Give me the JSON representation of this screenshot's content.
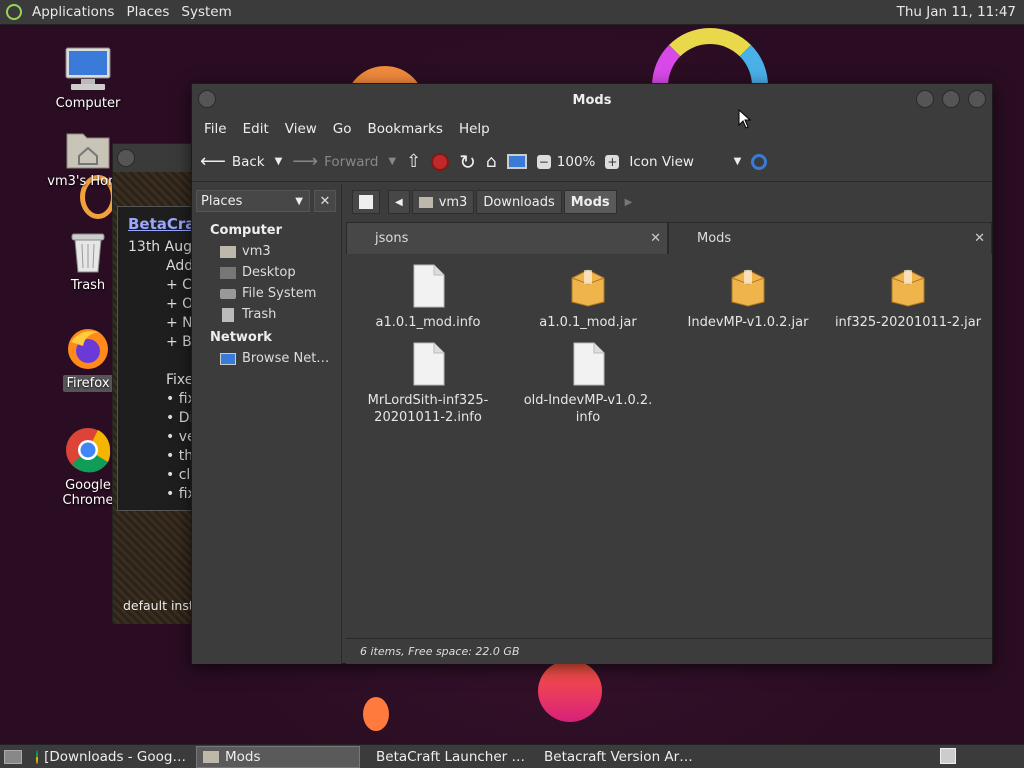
{
  "top_panel": {
    "menus": [
      "Applications",
      "Places",
      "System"
    ],
    "clock": "Thu Jan 11, 11:47"
  },
  "desktop_icons": [
    {
      "label": "Computer",
      "icon": "computer-icon"
    },
    {
      "label": "vm3's Home",
      "icon": "home-folder-icon"
    },
    {
      "label": "Trash",
      "icon": "trash-icon"
    },
    {
      "label": "Firefox",
      "icon": "firefox-icon"
    },
    {
      "label": "Google Chrome",
      "icon": "chrome-icon"
    }
  ],
  "bg_window": {
    "link": "BetaCraft",
    "lines": [
      "13th August",
      "Added",
      "+ C",
      "+ O",
      "+ N",
      "+ B",
      "",
      "Fixed",
      "• fix",
      "• Dis",
      "• ve",
      "• the",
      "• cli",
      "• fix"
    ],
    "footer": "default instance"
  },
  "file_manager": {
    "title": "Mods",
    "menu": [
      "File",
      "Edit",
      "View",
      "Go",
      "Bookmarks",
      "Help"
    ],
    "toolbar": {
      "back": "Back",
      "forward": "Forward",
      "zoom": "100%",
      "view_mode": "Icon View"
    },
    "places_label": "Places",
    "sidebar": {
      "computer_head": "Computer",
      "computer_items": [
        "vm3",
        "Desktop",
        "File System",
        "Trash"
      ],
      "network_head": "Network",
      "network_items": [
        "Browse Net…"
      ]
    },
    "path": [
      "vm3",
      "Downloads",
      "Mods"
    ],
    "tabs": [
      {
        "label": "jsons",
        "active": false
      },
      {
        "label": "Mods",
        "active": true
      }
    ],
    "files": [
      {
        "name": "a1.0.1_mod.info",
        "type": "document"
      },
      {
        "name": "a1.0.1_mod.jar",
        "type": "package"
      },
      {
        "name": "IndevMP-v1.0.2.jar",
        "type": "package"
      },
      {
        "name": "inf325-20201011-2.jar",
        "type": "package"
      },
      {
        "name": "MrLordSith-inf325-20201011-2.info",
        "line1": "MrLordSith-inf325-",
        "line2": "20201011-2.info",
        "type": "document"
      },
      {
        "name": "old-IndevMP-v1.0.2.info",
        "line1": "old-IndevMP-v1.0.2.",
        "line2": "info",
        "type": "document"
      }
    ],
    "status": "6 items, Free space: 22.0 GB"
  },
  "taskbar": [
    {
      "label": "[Downloads - Goog…",
      "icon": "chrome-icon",
      "active": false
    },
    {
      "label": "Mods",
      "icon": "folder-icon",
      "active": true
    },
    {
      "label": "BetaCraft Launcher …",
      "icon": "java-icon",
      "active": false
    },
    {
      "label": "Betacraft Version Ar…",
      "icon": "java-icon",
      "active": false
    }
  ]
}
